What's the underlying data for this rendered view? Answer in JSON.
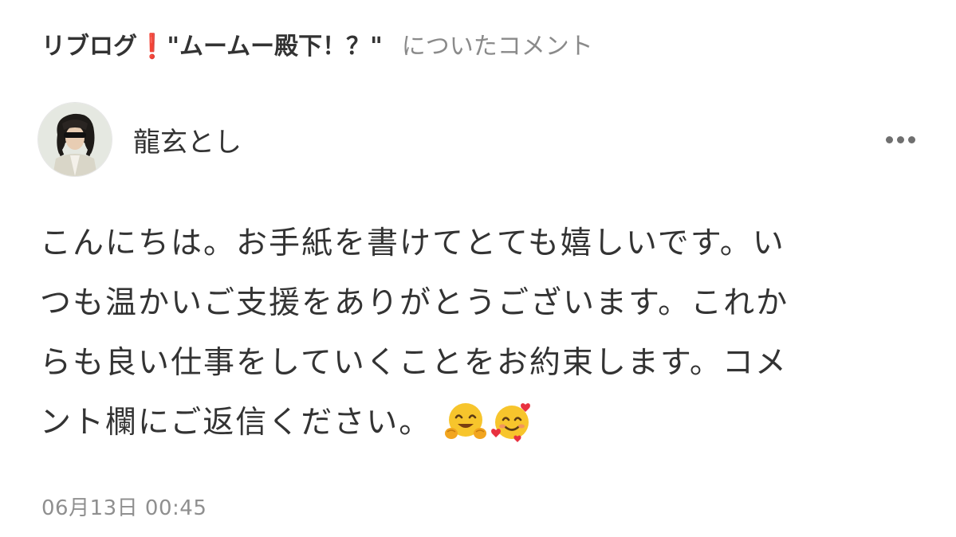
{
  "header": {
    "reblog_title": "リブログ❗\"ムームー殿下！？\"",
    "suffix": "についたコメント"
  },
  "author": {
    "name": "龍玄とし"
  },
  "comment": {
    "lines": [
      "こんにちは。お手紙を書けてとても嬉しいです。い",
      "つも温かいご支援をありがとうございます。これか",
      "らも良い仕事をしていくことをお約束します。コメ",
      "ント欄にご返信ください。"
    ],
    "emojis": [
      "hugging-face-emoji",
      "smiling-face-with-hearts-emoji"
    ]
  },
  "meta": {
    "timestamp": "06月13日 00:45"
  },
  "colors": {
    "text": "#333333",
    "muted": "#8a8a8a",
    "more_dots": "#6f6f6f",
    "avatar_border": "#e6e6e6"
  },
  "icons": {
    "more": "more-horizontal-icon"
  }
}
